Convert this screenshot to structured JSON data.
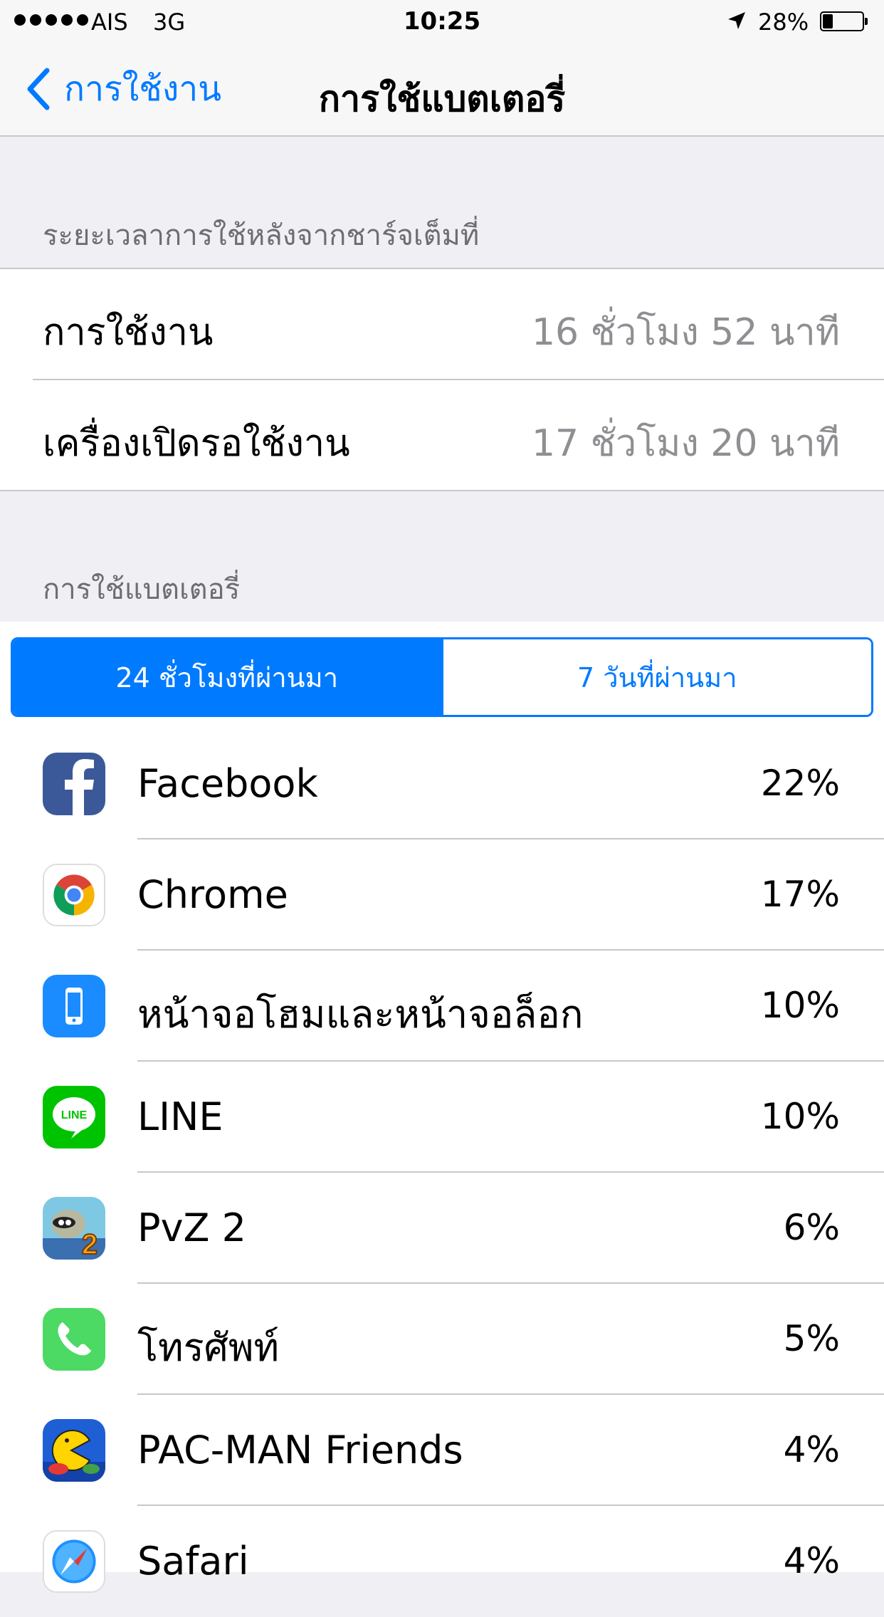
{
  "status_bar": {
    "carrier": "AIS",
    "network": "3G",
    "time": "10:25",
    "battery": "28%",
    "battery_level": 0.28,
    "signal_bars": 5
  },
  "nav": {
    "back_label": "การใช้งาน",
    "title": "การใช้แบตเตอรี่"
  },
  "usage_section": {
    "header": "ระยะเวลาการใช้หลังจากชาร์จเต็มที่",
    "rows": [
      {
        "label": "การใช้งาน",
        "value": "16 ชั่วโมง 52 นาที"
      },
      {
        "label": "เครื่องเปิดรอใช้งาน",
        "value": "17 ชั่วโมง 20 นาที"
      }
    ]
  },
  "battery_section": {
    "header": "การใช้แบตเตอรี่",
    "segments": [
      "24 ชั่วโมงที่ผ่านมา",
      "7 วันที่ผ่านมา"
    ],
    "selected_segment": 0
  },
  "apps": [
    {
      "name": "Facebook",
      "percent": "22%",
      "icon": "facebook-icon"
    },
    {
      "name": "Chrome",
      "percent": "17%",
      "icon": "chrome-icon"
    },
    {
      "name": "หน้าจอโฮมและหน้าจอล็อก",
      "percent": "10%",
      "icon": "home-lock-screen-icon"
    },
    {
      "name": "LINE",
      "percent": "10%",
      "icon": "line-icon"
    },
    {
      "name": "PvZ 2",
      "percent": "6%",
      "icon": "pvz2-icon"
    },
    {
      "name": "โทรศัพท์",
      "percent": "5%",
      "icon": "phone-icon"
    },
    {
      "name": "PAC-MAN Friends",
      "percent": "4%",
      "icon": "pacman-icon"
    },
    {
      "name": "Safari",
      "percent": "4%",
      "icon": "safari-icon"
    }
  ],
  "colors": {
    "accent": "#007aff",
    "background": "#efeff4",
    "separator": "#c8c7cc",
    "secondary_text": "#8e8e93"
  }
}
